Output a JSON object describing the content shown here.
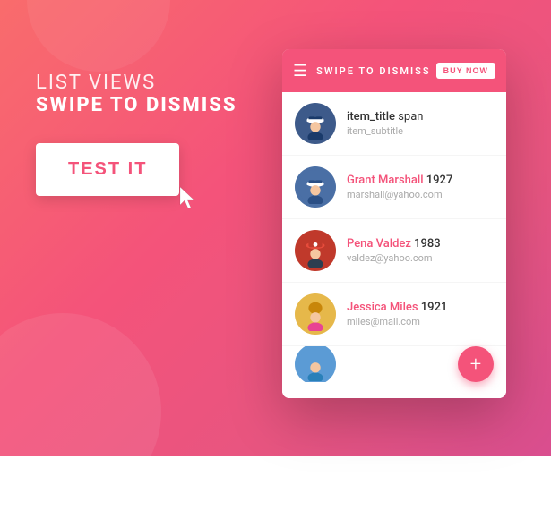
{
  "background": {
    "gradient_start": "#f96c6c",
    "gradient_end": "#d94e8f"
  },
  "left_panel": {
    "line1": "LIST VIEWS",
    "line2": "SWIPE TO DISMISS",
    "button_label": "TEST IT"
  },
  "phone": {
    "app_bar": {
      "title": "SWIPE TO DISMISS",
      "buy_now_label": "BUY NOW"
    },
    "fab_icon": "+",
    "list_items": [
      {
        "id": 1,
        "title_orange": "",
        "title_normal": "item_title",
        "title_suffix": " span",
        "subtitle": "item_subtitle",
        "avatar_color": "#3d5a8a"
      },
      {
        "id": 2,
        "title_orange": "Grant Marshall",
        "title_normal": "",
        "title_suffix": " 1927",
        "subtitle": "marshall@yahoo.com",
        "avatar_color": "#4a6fa5"
      },
      {
        "id": 3,
        "title_orange": "Pena Valdez",
        "title_normal": "",
        "title_suffix": " 1983",
        "subtitle": "valdez@yahoo.com",
        "avatar_color": "#c0392b"
      },
      {
        "id": 4,
        "title_orange": "Jessica Miles",
        "title_normal": "",
        "title_suffix": " 1921",
        "subtitle": "miles@mail.com",
        "avatar_color": "#e6b84a"
      },
      {
        "id": 5,
        "title_orange": "",
        "title_normal": "",
        "title_suffix": "",
        "subtitle": "",
        "avatar_color": "#5b9bd5"
      }
    ]
  }
}
